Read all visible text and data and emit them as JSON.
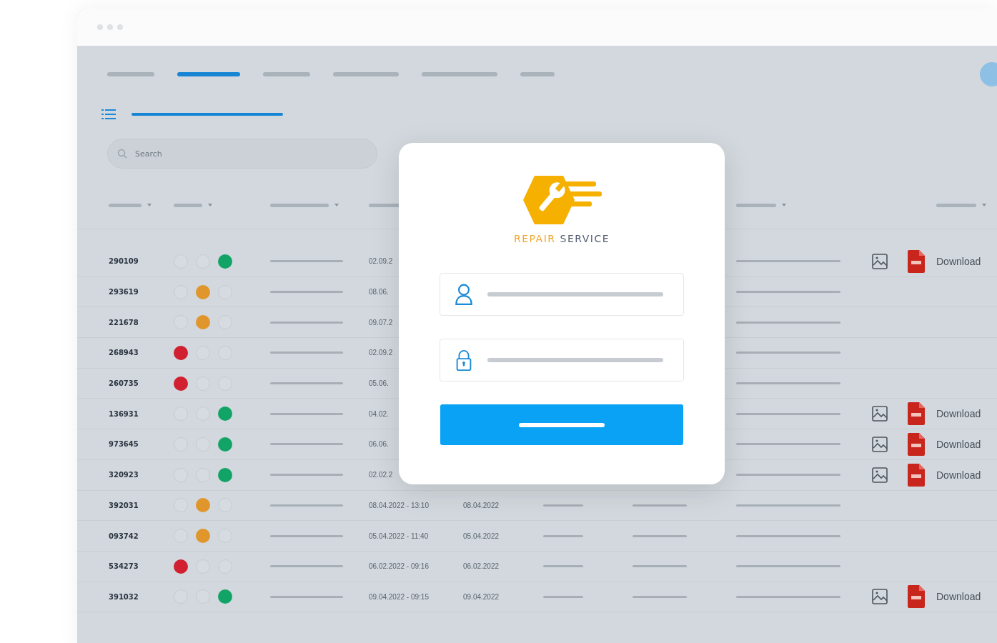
{
  "tabs": [
    {
      "selected": false
    },
    {
      "selected": true
    },
    {
      "selected": false
    },
    {
      "selected": false
    },
    {
      "selected": false
    },
    {
      "selected": false
    }
  ],
  "search": {
    "placeholder": "Search"
  },
  "rows": [
    {
      "id": "290109",
      "lights": [
        {
          "on": false
        },
        {
          "on": false
        },
        {
          "on": true,
          "color": "#12a366"
        }
      ],
      "date1": "02.09.2",
      "attachment": true,
      "download": "Download"
    },
    {
      "id": "293619",
      "lights": [
        {
          "on": false
        },
        {
          "on": true,
          "color": "#e0962a"
        },
        {
          "on": false
        }
      ],
      "date1": "08.06.",
      "attachment": false
    },
    {
      "id": "221678",
      "lights": [
        {
          "on": false
        },
        {
          "on": true,
          "color": "#e0962a"
        },
        {
          "on": false
        }
      ],
      "date1": "09.07.2",
      "attachment": false
    },
    {
      "id": "268943",
      "lights": [
        {
          "on": true,
          "color": "#d1202f"
        },
        {
          "on": false
        },
        {
          "on": false
        }
      ],
      "date1": "02.09.2",
      "attachment": false
    },
    {
      "id": "260735",
      "lights": [
        {
          "on": true,
          "color": "#d1202f"
        },
        {
          "on": false
        },
        {
          "on": false
        }
      ],
      "date1": "05.06.",
      "attachment": false
    },
    {
      "id": "136931",
      "lights": [
        {
          "on": false
        },
        {
          "on": false
        },
        {
          "on": true,
          "color": "#12a366"
        }
      ],
      "date1": "04.02.",
      "attachment": true,
      "download": "Download"
    },
    {
      "id": "973645",
      "lights": [
        {
          "on": false
        },
        {
          "on": false
        },
        {
          "on": true,
          "color": "#12a366"
        }
      ],
      "date1": "06.06.",
      "attachment": true,
      "download": "Download"
    },
    {
      "id": "320923",
      "lights": [
        {
          "on": false
        },
        {
          "on": false
        },
        {
          "on": true,
          "color": "#12a366"
        }
      ],
      "date1": "02.02.2",
      "attachment": true,
      "download": "Download"
    },
    {
      "id": "392031",
      "lights": [
        {
          "on": false
        },
        {
          "on": true,
          "color": "#e0962a"
        },
        {
          "on": false
        }
      ],
      "date1": "08.04.2022 - 13:10",
      "date2": "08.04.2022",
      "attachment": false
    },
    {
      "id": "093742",
      "lights": [
        {
          "on": false
        },
        {
          "on": true,
          "color": "#e0962a"
        },
        {
          "on": false
        }
      ],
      "date1": "05.04.2022 - 11:40",
      "date2": "05.04.2022",
      "attachment": false
    },
    {
      "id": "534273",
      "lights": [
        {
          "on": true,
          "color": "#d1202f"
        },
        {
          "on": false
        },
        {
          "on": false
        }
      ],
      "date1": "06.02.2022 - 09:16",
      "date2": "06.02.2022",
      "attachment": false
    },
    {
      "id": "391032",
      "lights": [
        {
          "on": false
        },
        {
          "on": false
        },
        {
          "on": true,
          "color": "#12a366"
        }
      ],
      "date1": "09.04.2022 - 09:15",
      "date2": "09.04.2022",
      "attachment": true,
      "download": "Download"
    }
  ],
  "login": {
    "brand_first": "REPAIR",
    "brand_second": "SERVICE"
  }
}
